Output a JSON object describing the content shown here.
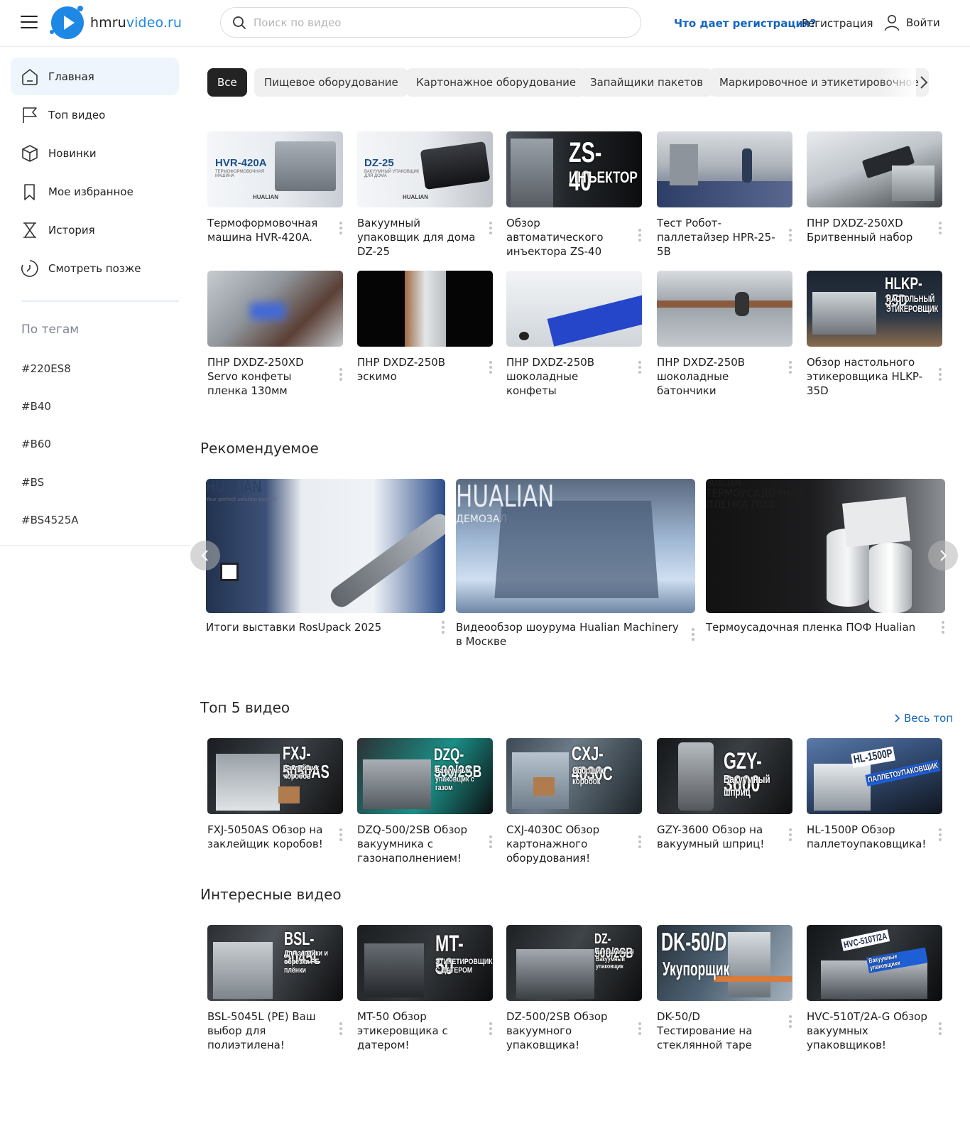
{
  "header": {
    "logo_main": "hmru",
    "logo_accent": "video.ru",
    "search_placeholder": "Поиск по видео",
    "reg_why": "Что дает регистрация?",
    "register": "Регистрация",
    "login": "Войти"
  },
  "sidebar": {
    "items": [
      {
        "label": "Главная",
        "icon": "home-icon"
      },
      {
        "label": "Топ видео",
        "icon": "flag-icon"
      },
      {
        "label": "Новинки",
        "icon": "box-icon"
      },
      {
        "label": "Мое избранное",
        "icon": "bookmark-icon"
      },
      {
        "label": "История",
        "icon": "hourglass-icon"
      },
      {
        "label": "Смотреть позже",
        "icon": "clock-icon"
      }
    ],
    "tags_title": "По тегам",
    "tags": [
      "#220ES8",
      "#B40",
      "#B60",
      "#BS",
      "#BS4525A"
    ]
  },
  "chips": [
    "Все",
    "Пищевое оборудование",
    "Картонажное оборудование",
    "Запайщики пакетов",
    "Маркировочное и этикетировочное"
  ],
  "grid": [
    {
      "title": "Термоформовочная машина HVR-420A.",
      "ov": "HVR-420A",
      "ov_sub": "ТЕРМОФОРМОВОЧНАЯ МАШИНА",
      "brand": "HUALIAN"
    },
    {
      "title": "Вакуумный упаковщик для дома DZ-25",
      "ov": "DZ-25",
      "ov_sub": "ВАКУУМНЫЙ УПАКОВЩИК ДЛЯ ДОМА",
      "brand": "HUALIAN"
    },
    {
      "title": "Обзор автоматического инъектора ZS-40",
      "ov": "ZS-40",
      "ov_sub": "ИНЪЕКТОР"
    },
    {
      "title": "Тест Робот-паллетайзер HPR-25-5B"
    },
    {
      "title": "ПНР DXDZ-250XD Бритвенный набор"
    },
    {
      "title": "ПНР DXDZ-250XD Servo конфеты пленка 130мм"
    },
    {
      "title": "ПНР DXDZ-250B эскимо"
    },
    {
      "title": "ПНР DXDZ-250B шоколадные конфеты"
    },
    {
      "title": "ПНР DXDZ-250B шоколадные батончики"
    },
    {
      "title": "Обзор настольного этикеровщика HLKP-35D",
      "ov": "HLKP-35D",
      "ov_sub": "НАСТОЛЬНЫЙ ЭТИКЕРОВЩИК"
    }
  ],
  "recommended": {
    "title": "Рекомендуемое",
    "items": [
      {
        "title": "Итоги выставки RosUpack 2025",
        "ov": "HUALIAN",
        "ov_sub": "Your perfect solution partner"
      },
      {
        "title": "Видеообзор шоурума Hualian Machinery в Москве",
        "ov": "HUALIAN",
        "ov_sub": "ДЕМОЗАЛ"
      },
      {
        "title": "Термоусадочная пленка ПОФ Hualian",
        "ov": "ТЕРМОУСАДОЧНАЯ",
        "ov_sub": "ПЛЕНКА ПОФ",
        "brand": "HUALIAN"
      }
    ]
  },
  "top5": {
    "title": "Топ 5 видео",
    "view_all": "Весь топ",
    "items": [
      {
        "title": "FXJ-5050AS Обзор на заклейщик коробов!",
        "ov": "FXJ-5050AS",
        "ov_sub": "Заклейщик коробов"
      },
      {
        "title": "DZQ-500/2SB Обзор вакуумника с газонаполнением!",
        "ov": "DZQ-500/2SB",
        "ov_sub": "Вакуумный упаковщик с газом"
      },
      {
        "title": "CXJ-4030C Обзор картонажного оборудования!",
        "ov": "CXJ-4030C",
        "ov_sub": "Сборщик коробок"
      },
      {
        "title": "GZY-3600 Обзор на вакуумный шприц!",
        "ov": "GZY-3600",
        "ov_sub": "Вакуумный шприц"
      },
      {
        "title": "HL-1500P Обзор паллетоупаковщика!",
        "ov": "HL-1500P",
        "ov_sub": "ПАЛЛЕТОУПАКОВЩИК"
      }
    ]
  },
  "interesting": {
    "title": "Интересные видео",
    "items": [
      {
        "title": "BSL-5045L (PE) Ваш выбор для полиэтилена!",
        "ov": "BSL-5045L",
        "ov_sub": "Для запайки и обрезки PE плёнки"
      },
      {
        "title": "MT-50 Обзор этикеровщика с датером!",
        "ov": "MT-50",
        "ov_sub": "ЭТИКЕТИРОВЩИК С ДАТЕРОМ"
      },
      {
        "title": "DZ-500/2SB Обзор вакуумного упаковщика!",
        "ov": "DZ-500/2SB",
        "ov_sub": "Двухкамерный Вакуумный упаковщик"
      },
      {
        "title": "DK-50/D Тестирование на стеклянной таре",
        "ov": "DK-50/D",
        "ov_sub": "Укупорщик"
      },
      {
        "title": "HVC-510T/2A-G Обзор вакуумных упаковщиков!",
        "ov": "HVC-510T/2A",
        "ov_sub": "Вакуумные упаковщики"
      }
    ]
  }
}
